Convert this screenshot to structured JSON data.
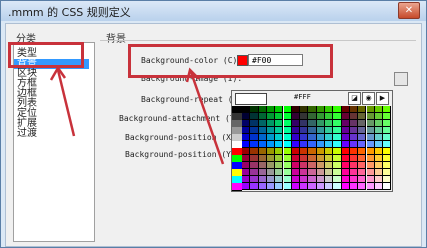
{
  "window": {
    "title": ".mmm 的 CSS 规则定义",
    "close_symbol": "✕"
  },
  "categories": {
    "header": "分类",
    "items": [
      {
        "label": "类型",
        "selected": false
      },
      {
        "label": "背景",
        "selected": true
      },
      {
        "label": "区块",
        "selected": false
      },
      {
        "label": "方框",
        "selected": false
      },
      {
        "label": "边框",
        "selected": false
      },
      {
        "label": "列表",
        "selected": false
      },
      {
        "label": "定位",
        "selected": false
      },
      {
        "label": "扩展",
        "selected": false
      },
      {
        "label": "过渡",
        "selected": false
      }
    ]
  },
  "background": {
    "title": "背景",
    "labels": {
      "color": "Background-color (C):",
      "image": "Background-image (I):",
      "repeat": "Background-repeat (R):",
      "attachment": "Background-attachment (T):",
      "position_x": "Background-position (X):",
      "position_y": "Background-position (Y):"
    },
    "color_value": "#F00",
    "color_swatch": "#ff0000"
  },
  "color_picker": {
    "preview_hex": "#FFF",
    "tool_nocolor": "◪",
    "tool_eyedrop": "◉",
    "tool_menu": "▶",
    "left_swatches": [
      "#000000",
      "#333333",
      "#666666",
      "#999999",
      "#cccccc",
      "#ffffff",
      "#ff0000",
      "#00ff00",
      "#0000ff",
      "#ffff00",
      "#00ffff",
      "#ff00ff"
    ]
  },
  "annotations": {
    "highlight_color": "#c8323b"
  }
}
